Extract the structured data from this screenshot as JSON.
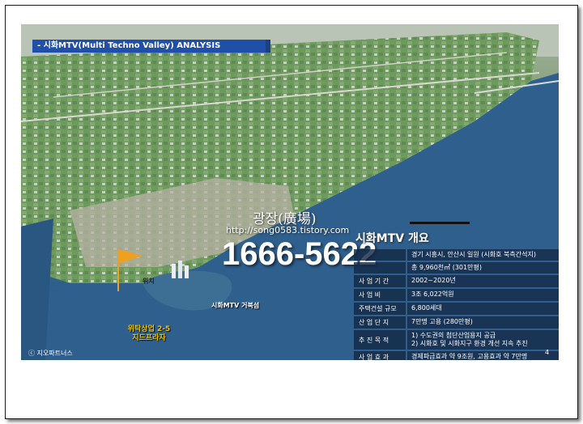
{
  "slide": {
    "title": "- 시화MTV(Multi Techno Valley) ANALYSIS",
    "page_number": "4",
    "copyright": "ⓒ 지오파트너스"
  },
  "watermark": {
    "title": "광장(廣場)",
    "url": "http://song0583.tistory.com",
    "phone": "1666-5622"
  },
  "map_labels": {
    "pin": "위치",
    "lake_district": "시화MTV 거북섬",
    "site_line1": "위탁상업 2-5",
    "site_line2": "지드프라자"
  },
  "overview": {
    "heading": "시화MTV 개요",
    "rows": [
      {
        "label": "",
        "value": "경기 시흥시, 안산시 일원 (시화호 북측간석지)"
      },
      {
        "label": "",
        "value": "총 9,960천㎡ (301만평)"
      },
      {
        "label": "사 업 기 간",
        "value": "2002~2020년"
      },
      {
        "label": "사 업 비",
        "value": "3조 6,022억원"
      },
      {
        "label": "주택건설 규모",
        "value": "6,800세대"
      },
      {
        "label": "산 업 단 지",
        "value": "7만명 고용 (280만평)"
      },
      {
        "label": "추 진 목 적",
        "value": "1) 수도권의 첨단산업용지 공급\n2) 시화호 및 시화지구 환경 개선 지속 추진"
      },
      {
        "label": "사 업 효 과",
        "value": "경제파급효과 약 9조원, 고용효과 약 7만명"
      }
    ]
  },
  "colors": {
    "title_bar": "#1f4fa8",
    "table_bg": "#14284699",
    "site_label": "#f2c200",
    "pin": "#f0a020"
  }
}
